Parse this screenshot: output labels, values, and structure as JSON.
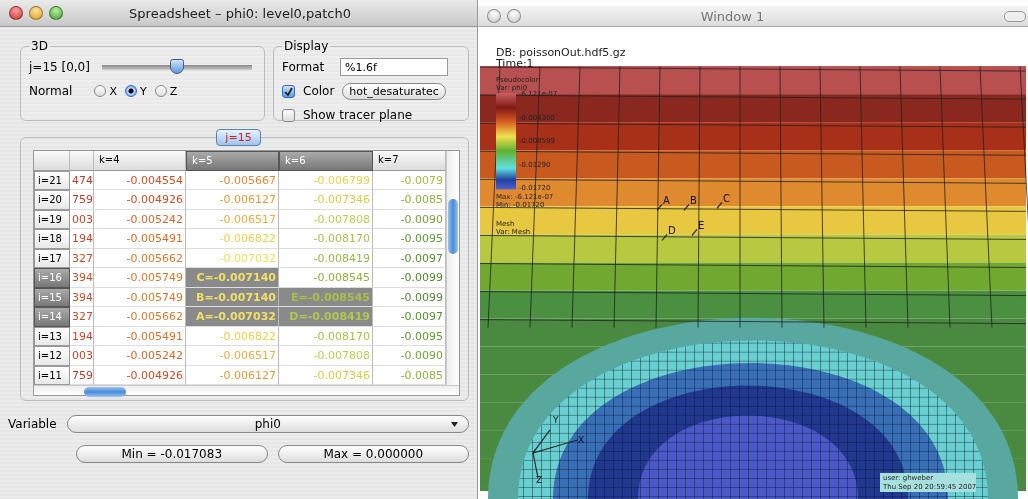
{
  "spreadsheet_window": {
    "title": "Spreadsheet – phi0: level0,patch0",
    "group_3d": {
      "label": "3D",
      "slice_label": "j=15 [0,0]",
      "slider": {
        "level": 0.5
      },
      "normal_label": "Normal",
      "normal_options": [
        {
          "label": "X",
          "selected": false
        },
        {
          "label": "Y",
          "selected": true
        },
        {
          "label": "Z",
          "selected": false
        }
      ]
    },
    "display": {
      "label": "Display",
      "format_label": "Format",
      "format_value": "%1.6f",
      "color": {
        "label": "Color",
        "checked": true,
        "colormap": "hot_desaturatec"
      },
      "tracer": {
        "label": "Show tracer plane",
        "checked": false
      }
    },
    "slice_tab": "j=15",
    "table": {
      "columns": [
        {
          "label": "k=4",
          "selected": false
        },
        {
          "label": "k=5",
          "selected": true
        },
        {
          "label": "k=6",
          "selected": true
        },
        {
          "label": "k=7",
          "selected": false
        }
      ],
      "rows": [
        {
          "header": "i=21",
          "selected": false,
          "cells": [
            {
              "text": "474",
              "color": "#b0402c",
              "selected": false
            },
            {
              "text": "-0.004554",
              "color": "#c8502a",
              "selected": false
            },
            {
              "text": "-0.005667",
              "color": "#d88a3a",
              "selected": false
            },
            {
              "text": "-0.006799",
              "color": "#e8d050",
              "selected": false
            },
            {
              "text": "-0.0079",
              "color": "#a8b848",
              "selected": false
            }
          ]
        },
        {
          "header": "i=20",
          "selected": false,
          "cells": [
            {
              "text": "759",
              "color": "#b0402c",
              "selected": false
            },
            {
              "text": "-0.004926",
              "color": "#c8502a",
              "selected": false
            },
            {
              "text": "-0.006127",
              "color": "#dc9a3c",
              "selected": false
            },
            {
              "text": "-0.007346",
              "color": "#d4cc48",
              "selected": false
            },
            {
              "text": "-0.0085",
              "color": "#90b040",
              "selected": false
            }
          ]
        },
        {
          "header": "i=19",
          "selected": false,
          "cells": [
            {
              "text": "003",
              "color": "#b8482c",
              "selected": false
            },
            {
              "text": "-0.005242",
              "color": "#d0682e",
              "selected": false
            },
            {
              "text": "-0.006517",
              "color": "#e0b048",
              "selected": false
            },
            {
              "text": "-0.007808",
              "color": "#c0cc58",
              "selected": false
            },
            {
              "text": "-0.0090",
              "color": "#78a040",
              "selected": false
            }
          ]
        },
        {
          "header": "i=18",
          "selected": false,
          "cells": [
            {
              "text": "194",
              "color": "#b8482c",
              "selected": false
            },
            {
              "text": "-0.005491",
              "color": "#d0702e",
              "selected": false
            },
            {
              "text": "-0.006822",
              "color": "#e8d050",
              "selected": false
            },
            {
              "text": "-0.008170",
              "color": "#a8c050",
              "selected": false
            },
            {
              "text": "-0.0095",
              "color": "#609838",
              "selected": false
            }
          ]
        },
        {
          "header": "i=17",
          "selected": false,
          "cells": [
            {
              "text": "327",
              "color": "#c0502c",
              "selected": false
            },
            {
              "text": "-0.005662",
              "color": "#d47a30",
              "selected": false
            },
            {
              "text": "-0.007032",
              "color": "#ece060",
              "selected": false
            },
            {
              "text": "-0.008419",
              "color": "#98b848",
              "selected": false
            },
            {
              "text": "-0.0097",
              "color": "#589030",
              "selected": false
            }
          ]
        },
        {
          "header": "i=16",
          "selected": true,
          "cells": [
            {
              "text": "394",
              "color": "#c0502c",
              "selected": false
            },
            {
              "text": "-0.005749",
              "color": "#d47a30",
              "selected": false
            },
            {
              "text": "C=-0.007140",
              "color": "#f0e068",
              "selected": true
            },
            {
              "text": "-0.008545",
              "color": "#90b040",
              "selected": false
            },
            {
              "text": "-0.0099",
              "color": "#508830",
              "selected": false
            }
          ]
        },
        {
          "header": "i=15",
          "selected": true,
          "cells": [
            {
              "text": "394",
              "color": "#c0502c",
              "selected": false
            },
            {
              "text": "-0.005749",
              "color": "#d47a30",
              "selected": false
            },
            {
              "text": "B=-0.007140",
              "color": "#f0e068",
              "selected": true
            },
            {
              "text": "E=-0.008545",
              "color": "#a8c048",
              "selected": true
            },
            {
              "text": "-0.0099",
              "color": "#508830",
              "selected": false
            }
          ]
        },
        {
          "header": "i=14",
          "selected": true,
          "cells": [
            {
              "text": "327",
              "color": "#c0502c",
              "selected": false
            },
            {
              "text": "-0.005662",
              "color": "#d47a30",
              "selected": false
            },
            {
              "text": "A=-0.007032",
              "color": "#f0e068",
              "selected": true
            },
            {
              "text": "D=-0.008419",
              "color": "#b0c850",
              "selected": true
            },
            {
              "text": "-0.0097",
              "color": "#589030",
              "selected": false
            }
          ]
        },
        {
          "header": "i=13",
          "selected": false,
          "cells": [
            {
              "text": "194",
              "color": "#b8482c",
              "selected": false
            },
            {
              "text": "-0.005491",
              "color": "#d0702e",
              "selected": false
            },
            {
              "text": "-0.006822",
              "color": "#e8d050",
              "selected": false
            },
            {
              "text": "-0.008170",
              "color": "#a8c050",
              "selected": false
            },
            {
              "text": "-0.0095",
              "color": "#609838",
              "selected": false
            }
          ]
        },
        {
          "header": "i=12",
          "selected": false,
          "cells": [
            {
              "text": "003",
              "color": "#b8482c",
              "selected": false
            },
            {
              "text": "-0.005242",
              "color": "#d0682e",
              "selected": false
            },
            {
              "text": "-0.006517",
              "color": "#e0b048",
              "selected": false
            },
            {
              "text": "-0.007808",
              "color": "#c0cc58",
              "selected": false
            },
            {
              "text": "-0.0090",
              "color": "#78a040",
              "selected": false
            }
          ]
        },
        {
          "header": "i=11",
          "selected": false,
          "cells": [
            {
              "text": "759",
              "color": "#b0402c",
              "selected": false
            },
            {
              "text": "-0.004926",
              "color": "#c8502a",
              "selected": false
            },
            {
              "text": "-0.006127",
              "color": "#dc9a3c",
              "selected": false
            },
            {
              "text": "-0.007346",
              "color": "#d4cc48",
              "selected": false
            },
            {
              "text": "-0.0085",
              "color": "#90b040",
              "selected": false
            }
          ]
        }
      ]
    },
    "variable": {
      "label": "Variable",
      "value": "phi0"
    },
    "min_button": "Min = -0.017083",
    "max_button": "Max = 0.000000"
  },
  "plot_window": {
    "title": "Window 1",
    "db": "DB: poissonOut.hdf5.gz",
    "time": "Time:1",
    "legend": {
      "title": "Pseudocolor",
      "var": "Var: phi0",
      "ticks": [
        "-6.121e-07",
        "-0.004300",
        "-0.008599",
        "-0.01290",
        "-0.01720"
      ],
      "max": "Max: -6.121e-07",
      "min": "Min: -0.01720"
    },
    "mesh_legend": {
      "title": "Mesh",
      "var": "Var: Mesh"
    },
    "point_labels": [
      "A",
      "B",
      "C",
      "D",
      "E"
    ],
    "axis_labels": [
      "Y",
      "X",
      "Z"
    ],
    "user": "user: ghweber",
    "date": "Thu Sep 20 20:59:45 2007"
  }
}
